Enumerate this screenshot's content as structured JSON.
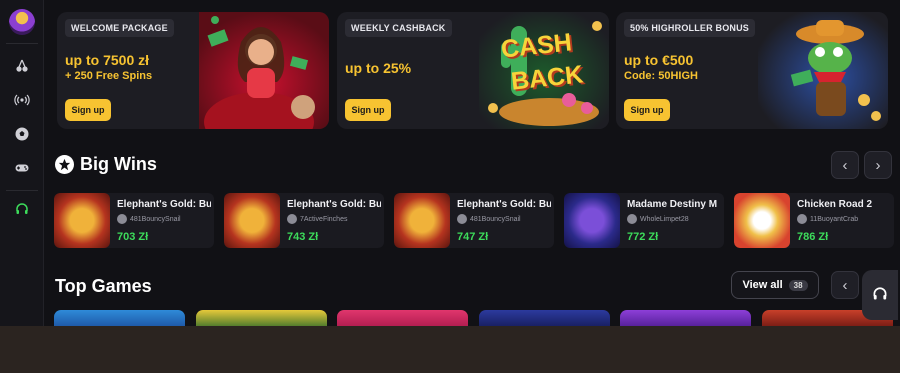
{
  "sidebar": {
    "items": [
      {
        "name": "slots-icon"
      },
      {
        "name": "live-icon"
      },
      {
        "name": "sports-icon"
      },
      {
        "name": "games-icon"
      },
      {
        "name": "support-icon"
      }
    ]
  },
  "promos": [
    {
      "tag": "WELCOME PACKAGE",
      "line1": "up to 7500 zł",
      "line2": "+ 250 Free Spins",
      "button": "Sign up"
    },
    {
      "tag": "WEEKLY CASHBACK",
      "line1": "up to 25%",
      "line2": "",
      "button": "Sign up",
      "art_text_1": "CASH",
      "art_text_2": "BACK"
    },
    {
      "tag": "50% HIGHROLLER BONUS",
      "line1": "up to €500",
      "line2": "Code: 50HIGH",
      "button": "Sign up"
    }
  ],
  "big_wins": {
    "title": "Big Wins",
    "items": [
      {
        "game": "Elephant's Gold: Bu",
        "user": "481BouncySnail",
        "amount": "703 Zł"
      },
      {
        "game": "Elephant's Gold: Bu",
        "user": "7ActiveFinches",
        "amount": "743 Zł"
      },
      {
        "game": "Elephant's Gold: Bu",
        "user": "481BouncySnail",
        "amount": "747 Zł"
      },
      {
        "game": "Madame Destiny M",
        "user": "WholeLimpet28",
        "amount": "772 Zł"
      },
      {
        "game": "Chicken Road 2",
        "user": "11BuoyantCrab",
        "amount": "786 Zł"
      }
    ]
  },
  "top_games": {
    "title": "Top Games",
    "view_all": "View all",
    "count": "38"
  },
  "colors": {
    "accent": "#f7c331",
    "win": "#3ddc5b",
    "background": "#111115"
  }
}
